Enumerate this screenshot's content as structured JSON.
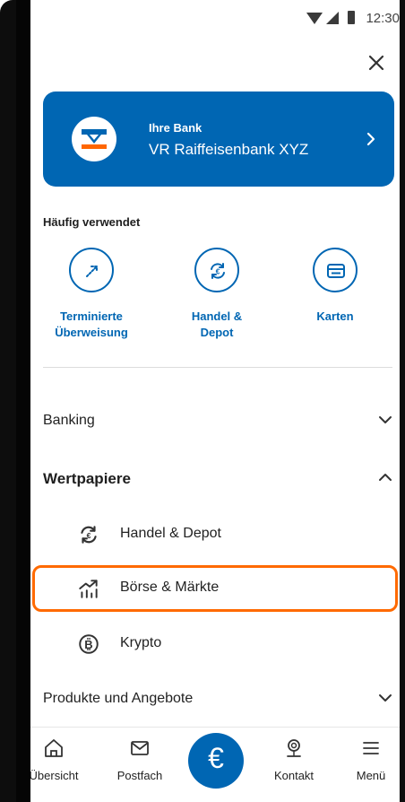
{
  "status_bar": {
    "time": "12:30"
  },
  "bank_card": {
    "label": "Ihre Bank",
    "name": "VR Raiffeisenbank XYZ"
  },
  "frequently_used": {
    "heading": "Häufig verwendet",
    "items": [
      {
        "label": "Terminierte\nÜberweisung",
        "icon": "scheduled-transfer-icon"
      },
      {
        "label": "Handel &\nDepot",
        "icon": "trading-exchange-icon"
      },
      {
        "label": "Karten",
        "icon": "card-icon"
      }
    ]
  },
  "menu": {
    "banking": "Banking",
    "securities": {
      "label": "Wertpapiere",
      "items": [
        {
          "label": "Handel & Depot",
          "icon": "trading-exchange-icon"
        },
        {
          "label": "Börse & Märkte",
          "icon": "market-chart-icon",
          "highlighted": true
        },
        {
          "label": "Krypto",
          "icon": "bitcoin-icon"
        }
      ]
    },
    "products": "Produkte und Angebote"
  },
  "bottom_nav": {
    "overview": "Übersicht",
    "mailbox": "Postfach",
    "center_symbol": "€",
    "contact": "Kontakt",
    "menu": "Menü"
  },
  "colors": {
    "brand_blue": "#0066b3",
    "highlight_orange": "#ff6a00",
    "logo_orange": "#ff6600"
  }
}
